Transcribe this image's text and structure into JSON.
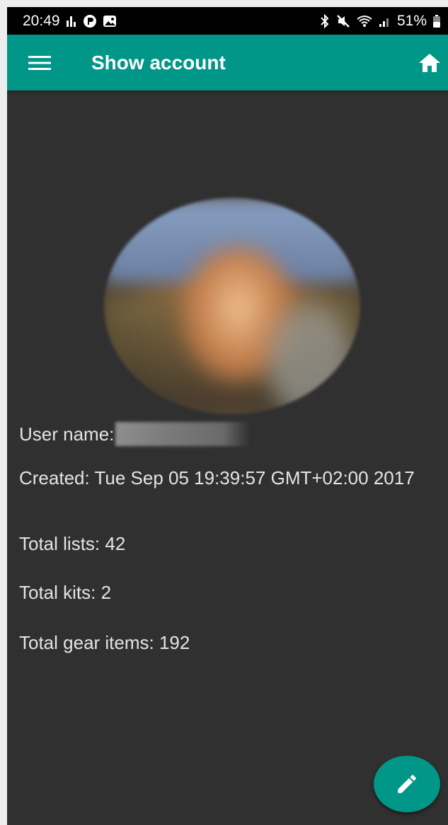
{
  "status_bar": {
    "time": "20:49",
    "battery": "51%",
    "left_icons": [
      "activity-icon",
      "app-notification-icon",
      "image-icon"
    ],
    "right_icons": [
      "bluetooth-icon",
      "mute-icon",
      "wifi-icon",
      "signal-icon",
      "battery-icon"
    ]
  },
  "app_bar": {
    "title": "Show account",
    "menu_icon": "menu-icon",
    "home_icon": "home-icon",
    "color": "#009688"
  },
  "account": {
    "user_name_label": "User name:",
    "user_name_value": "",
    "created": "Created: Tue Sep 05 19:39:57 GMT+02:00 2017",
    "total_lists": "Total lists: 42",
    "total_kits": "Total kits: 2",
    "total_gear_items": "Total gear items: 192"
  },
  "fab": {
    "icon": "edit-icon",
    "color": "#009688"
  },
  "colors": {
    "background": "#303030",
    "text": "#e4e4e4",
    "accent": "#009688"
  }
}
